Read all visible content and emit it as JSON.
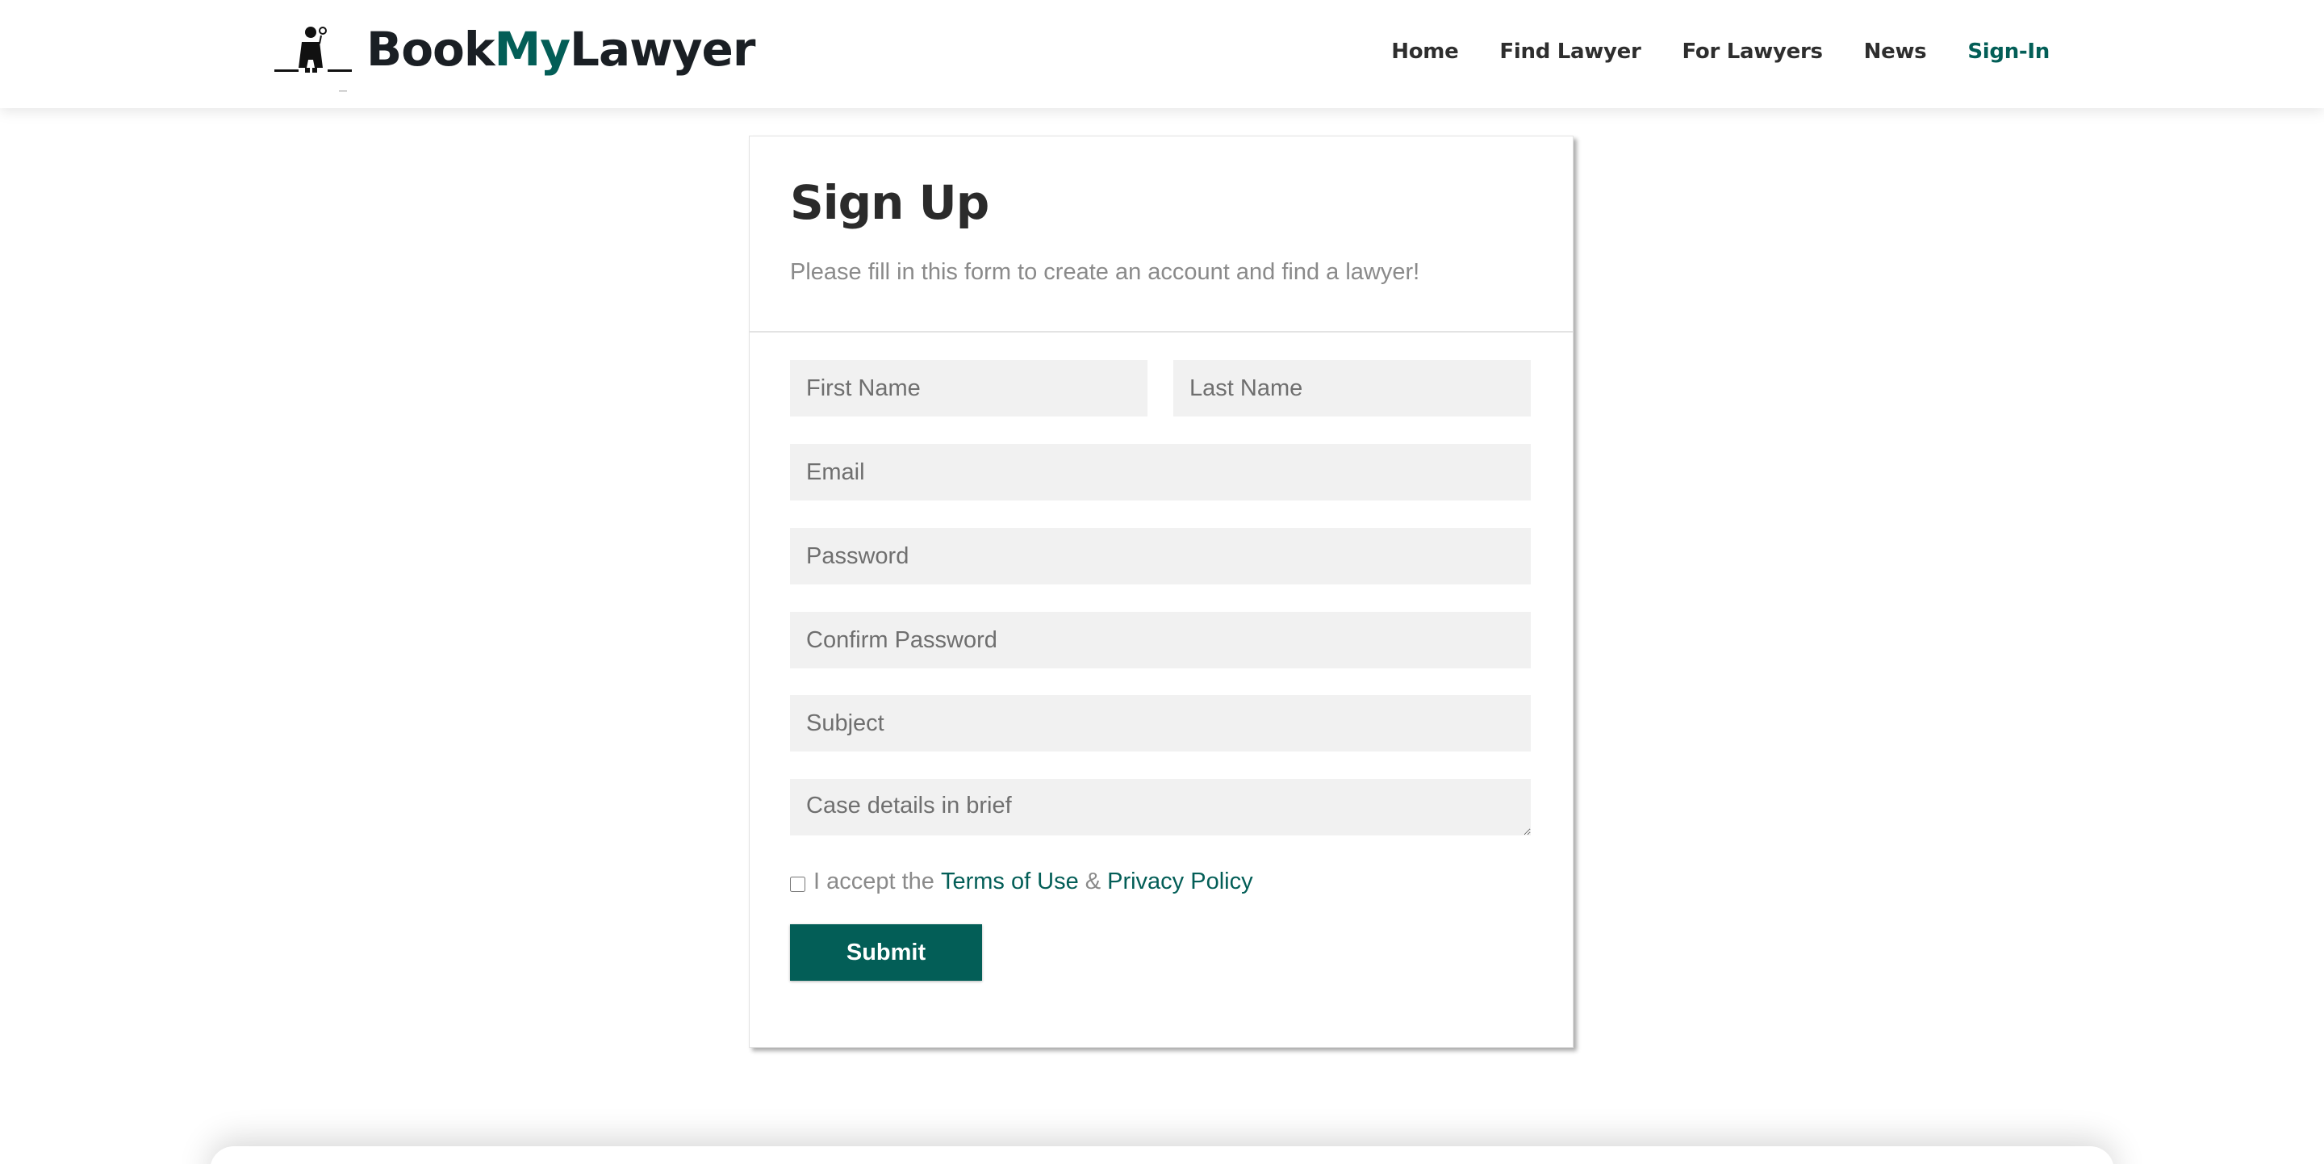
{
  "header": {
    "logo": {
      "part1": "Book",
      "part2": "My",
      "part3": "Lawyer",
      "icon": "lawyer-figure-icon"
    },
    "nav": [
      {
        "label": "Home",
        "active": false
      },
      {
        "label": "Find Lawyer",
        "active": false
      },
      {
        "label": "For Lawyers",
        "active": false
      },
      {
        "label": "News",
        "active": false
      },
      {
        "label": "Sign-In",
        "active": true
      }
    ]
  },
  "form": {
    "title": "Sign Up",
    "subtitle": "Please fill in this form to create an account and find a lawyer!",
    "fields": {
      "first_name": {
        "placeholder": "First Name",
        "value": ""
      },
      "last_name": {
        "placeholder": "Last Name",
        "value": ""
      },
      "email": {
        "placeholder": "Email",
        "value": ""
      },
      "password": {
        "placeholder": "Password",
        "value": ""
      },
      "confirm_password": {
        "placeholder": "Confirm Password",
        "value": ""
      },
      "subject": {
        "placeholder": "Subject",
        "value": ""
      },
      "case_details": {
        "placeholder": "Case details in brief",
        "value": ""
      }
    },
    "terms": {
      "checked": false,
      "prefix": "I accept the",
      "terms_link": "Terms of Use",
      "separator": "&",
      "privacy_link": "Privacy Policy"
    },
    "submit_label": "Submit"
  },
  "colors": {
    "accent": "#035e57",
    "text_dark": "#2b2b2b",
    "text_muted": "#8a8a8a",
    "field_bg": "#f1f1f1"
  }
}
